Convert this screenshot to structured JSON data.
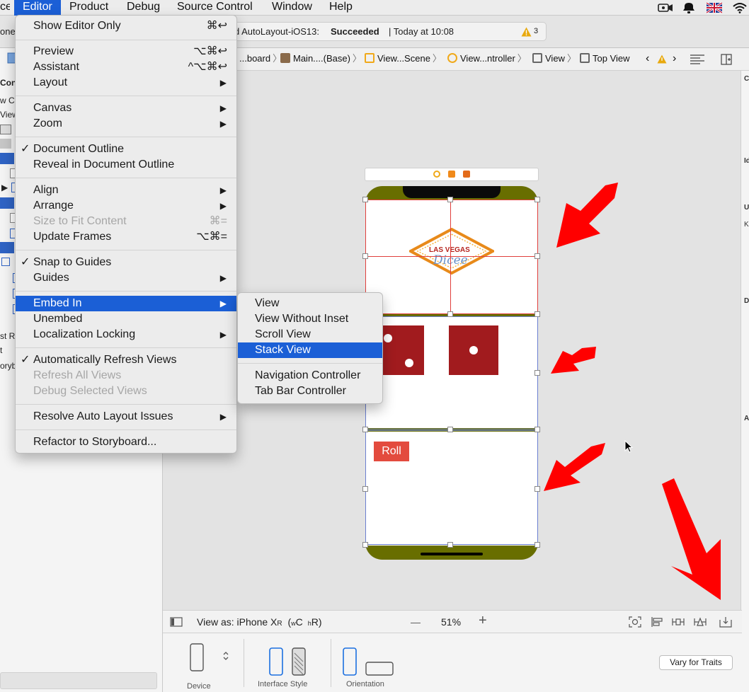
{
  "menubar": {
    "items": [
      "ce",
      "Editor",
      "Product",
      "Debug",
      "Source Control",
      "Window",
      "Help"
    ],
    "active": "Editor"
  },
  "toolbar": {
    "scheme_fragment": "one",
    "activity_project": "d AutoLayout-iOS13:",
    "activity_status": "Succeeded",
    "activity_time": "| Today at 10:08",
    "warning_count": "3"
  },
  "navigator": {
    "fragments": [
      "Con",
      "w C",
      "View",
      "st R",
      "t",
      "oryb"
    ]
  },
  "jumpbar": {
    "crumbs": [
      "...board",
      "Main....(Base)",
      "View...Scene",
      "View...ntroller",
      "View",
      "Top View"
    ]
  },
  "canvas": {
    "logo_top": "LAS VEGAS",
    "logo_script": "Dicee",
    "roll_button": "Roll"
  },
  "editor_bottom": {
    "view_as_prefix": "View as: ",
    "device_name": "iPhone X",
    "device_sub": "R",
    "size_class_w1": "w",
    "size_class_w2": "C",
    "size_class_h1": "h",
    "size_class_h2": "R",
    "zoom_minus": "—",
    "zoom": "51%",
    "zoom_plus": "+"
  },
  "device_bar": {
    "device_label": "Device",
    "interface_style_label": "Interface Style",
    "orientation_label": "Orientation",
    "vary_button": "Vary for Traits"
  },
  "inspector_fragments": [
    "C",
    "Id",
    "U",
    "K",
    "D",
    "A"
  ],
  "editor_menu": {
    "items": [
      {
        "label": "Show Editor Only",
        "shortcut": "⌘↩",
        "check": "",
        "submenu": false,
        "enabled": true
      },
      {
        "label": "Preview",
        "shortcut": "⌥⌘↩",
        "check": "",
        "submenu": false,
        "enabled": true
      },
      {
        "label": "Assistant",
        "shortcut": "^⌥⌘↩",
        "check": "",
        "submenu": false,
        "enabled": true
      },
      {
        "label": "Layout",
        "shortcut": "",
        "check": "",
        "submenu": true,
        "enabled": true
      },
      {
        "label": "Canvas",
        "shortcut": "",
        "check": "",
        "submenu": true,
        "enabled": true
      },
      {
        "label": "Zoom",
        "shortcut": "",
        "check": "",
        "submenu": true,
        "enabled": true
      },
      {
        "label": "Document Outline",
        "shortcut": "",
        "check": "✓",
        "submenu": false,
        "enabled": true
      },
      {
        "label": "Reveal in Document Outline",
        "shortcut": "",
        "check": "",
        "submenu": false,
        "enabled": true
      },
      {
        "label": "Align",
        "shortcut": "",
        "check": "",
        "submenu": true,
        "enabled": true
      },
      {
        "label": "Arrange",
        "shortcut": "",
        "check": "",
        "submenu": true,
        "enabled": true
      },
      {
        "label": "Size to Fit Content",
        "shortcut": "⌘=",
        "check": "",
        "submenu": false,
        "enabled": false
      },
      {
        "label": "Update Frames",
        "shortcut": "⌥⌘=",
        "check": "",
        "submenu": false,
        "enabled": true
      },
      {
        "label": "Snap to Guides",
        "shortcut": "",
        "check": "✓",
        "submenu": false,
        "enabled": true
      },
      {
        "label": "Guides",
        "shortcut": "",
        "check": "",
        "submenu": true,
        "enabled": true
      },
      {
        "label": "Embed In",
        "shortcut": "",
        "check": "",
        "submenu": true,
        "enabled": true
      },
      {
        "label": "Unembed",
        "shortcut": "",
        "check": "",
        "submenu": false,
        "enabled": true
      },
      {
        "label": "Localization Locking",
        "shortcut": "",
        "check": "",
        "submenu": true,
        "enabled": true
      },
      {
        "label": "Automatically Refresh Views",
        "shortcut": "",
        "check": "✓",
        "submenu": false,
        "enabled": true
      },
      {
        "label": "Refresh All Views",
        "shortcut": "",
        "check": "",
        "submenu": false,
        "enabled": false
      },
      {
        "label": "Debug Selected Views",
        "shortcut": "",
        "check": "",
        "submenu": false,
        "enabled": false
      },
      {
        "label": "Resolve Auto Layout Issues",
        "shortcut": "",
        "check": "",
        "submenu": true,
        "enabled": true
      },
      {
        "label": "Refactor to Storyboard...",
        "shortcut": "",
        "check": "",
        "submenu": false,
        "enabled": true
      }
    ],
    "highlighted": "Embed In"
  },
  "embed_submenu": {
    "items": [
      "View",
      "View Without Inset",
      "Scroll View",
      "Stack View",
      "Navigation Controller",
      "Tab Bar Controller"
    ],
    "highlighted": "Stack View"
  },
  "colors": {
    "menu_highlight": "#1b5fd6",
    "dice": "#a11b1e",
    "roll_button": "#e34b3e",
    "annotation_arrow": "#ff0000",
    "view_background": "#686e00"
  }
}
